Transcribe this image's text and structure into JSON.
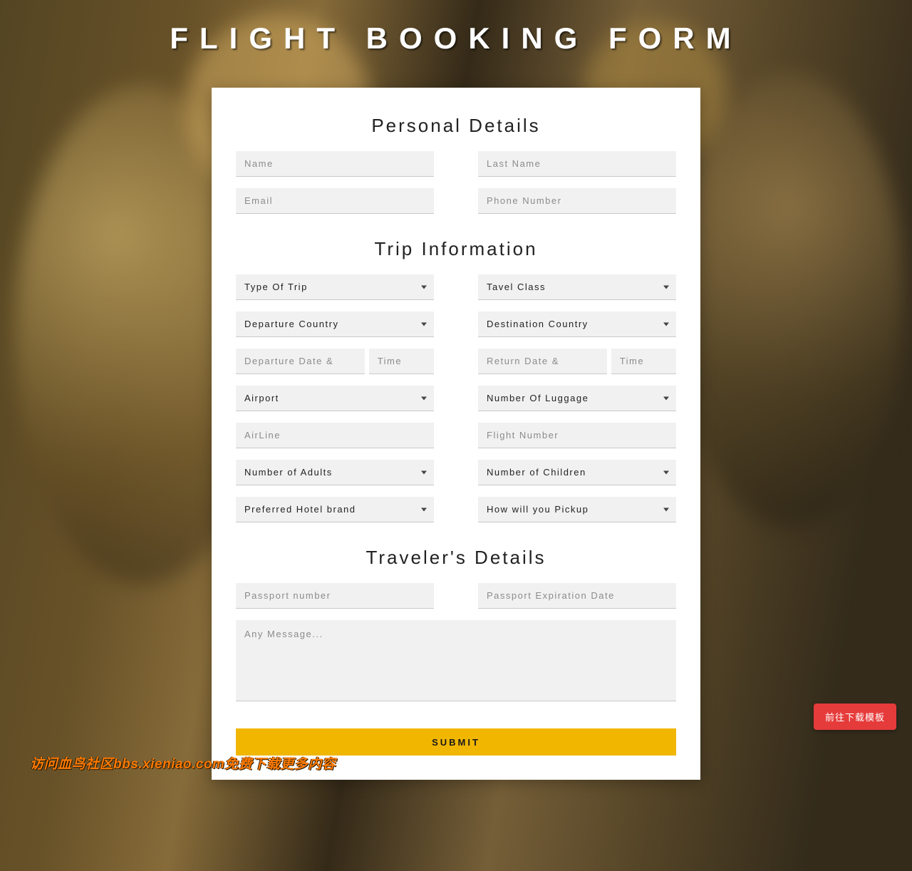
{
  "header": {
    "title": "FLIGHT BOOKING FORM"
  },
  "sections": {
    "personal": "Personal Details",
    "trip": "Trip Information",
    "traveler": "Traveler's Details"
  },
  "personal": {
    "name_ph": "Name",
    "lastname_ph": "Last Name",
    "email_ph": "Email",
    "phone_ph": "Phone Number"
  },
  "trip": {
    "trip_type": "Type Of Trip",
    "travel_class": "Tavel Class",
    "dep_country": "Departure Country",
    "dest_country": "Destination Country",
    "dep_date_ph": "Departure Date &",
    "dep_time_ph": "Time",
    "ret_date_ph": "Return Date &",
    "ret_time_ph": "Time",
    "airport": "Airport",
    "luggage": "Number Of Luggage",
    "airline_ph": "AirLine",
    "flight_no_ph": "Flight Number",
    "adults": "Number of Adults",
    "children": "Number of Children",
    "hotel": "Preferred Hotel brand",
    "pickup": "How will you Pickup"
  },
  "traveler": {
    "passport_ph": "Passport number",
    "passport_exp_ph": "Passport Expiration Date",
    "message_ph": "Any Message..."
  },
  "submit_label": "SUBMIT",
  "overlay_text": "访问血鸟社区bbs.xieniao.com免费下载更多内容",
  "float_button": "前往下载模板"
}
